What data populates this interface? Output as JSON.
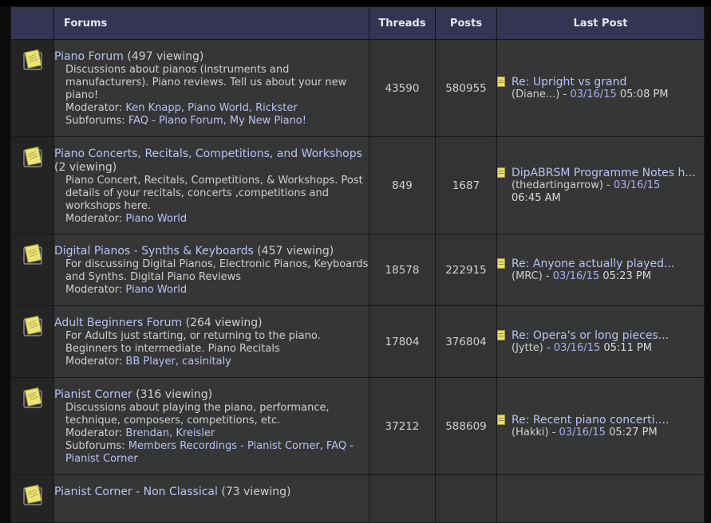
{
  "header": {
    "forums": "Forums",
    "threads": "Threads",
    "posts": "Posts",
    "last_post": "Last Post"
  },
  "forums": [
    {
      "title": "Piano Forum",
      "viewing": "(497 viewing)",
      "desc": "Discussions about pianos (instruments and manufacturers). Piano reviews. Tell us about your new piano!",
      "moderator_label": "Moderator:",
      "moderators": "Ken Knapp, Piano World, Rickster",
      "subforums_label": "Subforums:",
      "subforums": "FAQ - Piano Forum, My New Piano!",
      "threads": "43590",
      "posts": "580955",
      "lp_title": "Re: Upright vs grand",
      "lp_author": "(Diane...)",
      "lp_sep": " - ",
      "lp_date": "03/16/15",
      "lp_time": "05:08 PM"
    },
    {
      "title": "Piano Concerts, Recitals, Competitions, and Workshops",
      "viewing": "(2 viewing)",
      "desc": "Piano Concert, Recitals, Competitions, & Workshops. Post details of your recitals, concerts ,competitions and workshops here.",
      "moderator_label": "Moderator:",
      "moderators": "Piano World",
      "threads": "849",
      "posts": "1687",
      "lp_title": "DipABRSM Programme Notes h...",
      "lp_author": "(thedartingarrow)",
      "lp_sep": " - ",
      "lp_date": "03/16/15",
      "lp_time": "06:45 AM"
    },
    {
      "title": "Digital Pianos - Synths & Keyboards",
      "viewing": "(457 viewing)",
      "desc": "For discussing Digital Pianos, Electronic Pianos, Keyboards and Synths. Digital Piano Reviews",
      "moderator_label": "Moderator:",
      "moderators": "Piano World",
      "threads": "18578",
      "posts": "222915",
      "lp_title": "Re: Anyone actually played...",
      "lp_author": "(MRC)",
      "lp_sep": " - ",
      "lp_date": "03/16/15",
      "lp_time": "05:23 PM"
    },
    {
      "title": "Adult Beginners Forum",
      "viewing": "(264 viewing)",
      "desc": "For Adults just starting, or returning to the piano. Beginners to intermediate. Piano Recitals",
      "moderator_label": "Moderator:",
      "moderators": "BB Player, casinitaly",
      "threads": "17804",
      "posts": "376804",
      "lp_title": "Re: Opera's or long pieces...",
      "lp_author": "(Jytte)",
      "lp_sep": " - ",
      "lp_date": "03/16/15",
      "lp_time": "05:11 PM"
    },
    {
      "title": "Pianist Corner",
      "viewing": "(316 viewing)",
      "desc": "Discussions about playing the piano, performance, technique, composers, competitions, etc.",
      "moderator_label": "Moderator:",
      "moderators": "Brendan, Kreisler",
      "subforums_label": "Subforums:",
      "subforums": "Members Recordings - Pianist Corner, FAQ - Pianist Corner",
      "threads": "37212",
      "posts": "588609",
      "lp_title": "Re: Recent piano concerti....",
      "lp_author": "(Hakki)",
      "lp_sep": " - ",
      "lp_date": "03/16/15",
      "lp_time": "05:27 PM"
    },
    {
      "title": "Pianist Corner - Non Classical",
      "viewing": "(73 viewing)"
    }
  ]
}
